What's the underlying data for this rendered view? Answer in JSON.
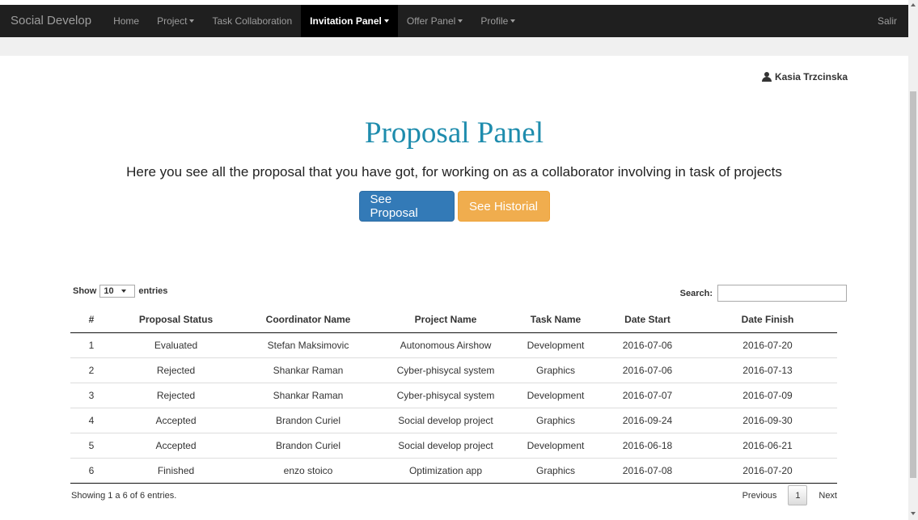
{
  "navbar": {
    "brand": "Social Develop",
    "items": [
      {
        "label": "Home",
        "dropdown": false,
        "active": false
      },
      {
        "label": "Project",
        "dropdown": true,
        "active": false
      },
      {
        "label": "Task Collaboration",
        "dropdown": false,
        "active": false
      },
      {
        "label": "Invitation Panel",
        "dropdown": true,
        "active": true
      },
      {
        "label": "Offer Panel",
        "dropdown": true,
        "active": false
      },
      {
        "label": "Profile",
        "dropdown": true,
        "active": false
      }
    ],
    "right_link": "Salir"
  },
  "user": {
    "name": "Kasia Trzcinska",
    "icon": "user-icon"
  },
  "page": {
    "title": "Proposal Panel",
    "subtitle": "Here you see all the proposal that you have got, for working on as a collaborator involving in task of projects",
    "buttons": {
      "primary": "See Proposal",
      "secondary": "See Historial"
    }
  },
  "table_controls": {
    "show_label": "Show",
    "entries_value": "10",
    "entries_label": "entries",
    "search_label": "Search:",
    "search_value": ""
  },
  "table": {
    "headers": [
      "#",
      "Proposal Status",
      "Coordinator Name",
      "Project Name",
      "Task Name",
      "Date Start",
      "Date Finish"
    ],
    "rows": [
      [
        "1",
        "Evaluated",
        "Stefan Maksimovic",
        "Autonomous Airshow",
        "Development",
        "2016-07-06",
        "2016-07-20"
      ],
      [
        "2",
        "Rejected",
        "Shankar Raman",
        "Cyber-phisycal system",
        "Graphics",
        "2016-07-06",
        "2016-07-13"
      ],
      [
        "3",
        "Rejected",
        "Shankar Raman",
        "Cyber-phisycal system",
        "Development",
        "2016-07-07",
        "2016-07-09"
      ],
      [
        "4",
        "Accepted",
        "Brandon Curiel",
        "Social develop project",
        "Graphics",
        "2016-09-24",
        "2016-09-30"
      ],
      [
        "5",
        "Accepted",
        "Brandon Curiel",
        "Social develop project",
        "Development",
        "2016-06-18",
        "2016-06-21"
      ],
      [
        "6",
        "Finished",
        "enzo stoico",
        "Optimization app",
        "Graphics",
        "2016-07-08",
        "2016-07-20"
      ]
    ]
  },
  "footer": {
    "info": "Showing 1 a 6 of 6 entries.",
    "previous": "Previous",
    "current_page": "1",
    "next": "Next"
  },
  "colors": {
    "navbar_bg": "#1f1f1f",
    "title": "#1e8cad",
    "primary_button": "#337ab7",
    "warning_button": "#f0ad4e"
  }
}
